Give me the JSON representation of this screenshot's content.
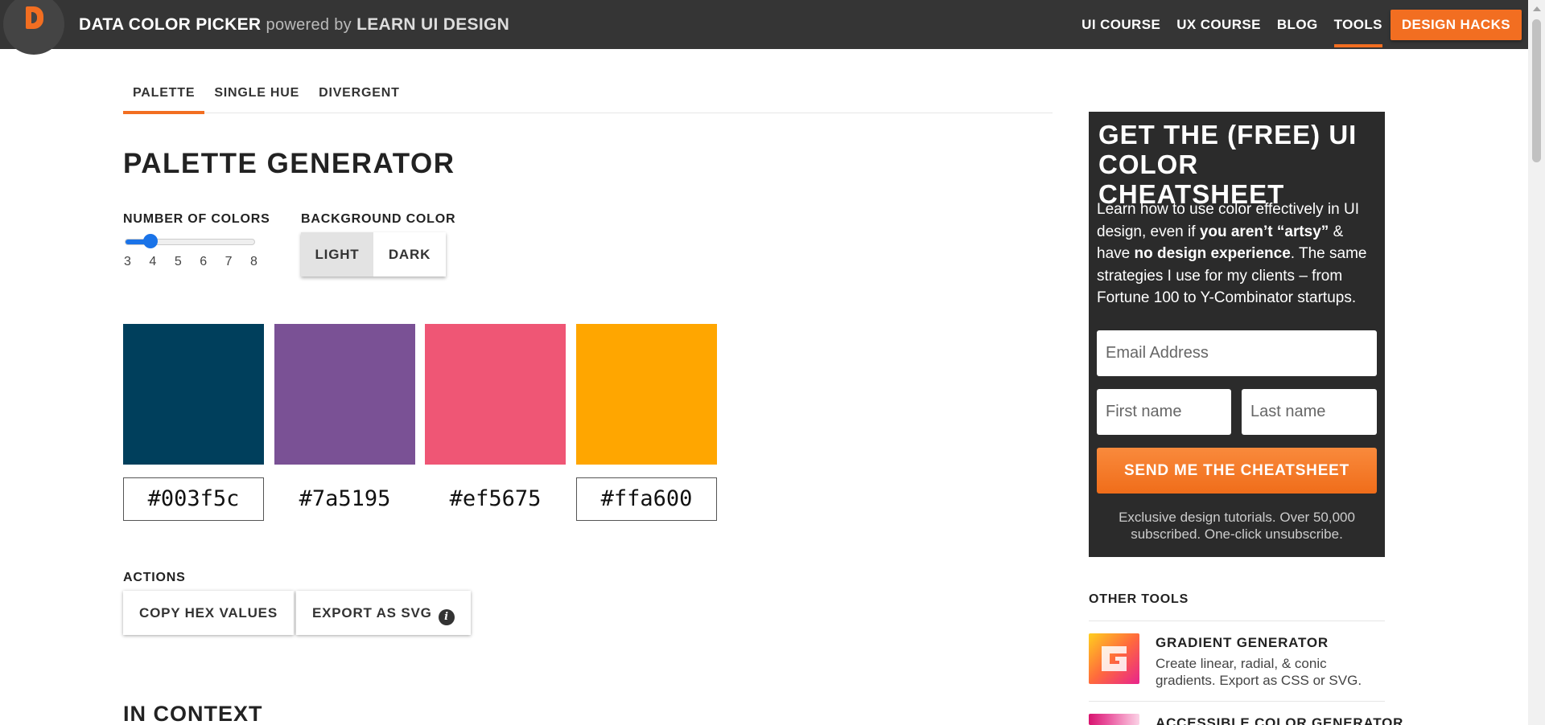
{
  "header": {
    "brand": "DATA COLOR PICKER",
    "powered_by": "powered by",
    "brand_parent": "LEARN UI DESIGN",
    "nav": [
      "UI COURSE",
      "UX COURSE",
      "BLOG",
      "TOOLS"
    ],
    "cta": "DESIGN HACKS",
    "accent": "#f26e21"
  },
  "tabs": [
    "PALETTE",
    "SINGLE HUE",
    "DIVERGENT"
  ],
  "page_title": "PALETTE GENERATOR",
  "controls": {
    "num_colors_label": "NUMBER OF COLORS",
    "ticks": [
      "3",
      "4",
      "5",
      "6",
      "7",
      "8"
    ],
    "selected_count": 4,
    "bg_label": "BACKGROUND COLOR",
    "bg_options": [
      "LIGHT",
      "DARK"
    ],
    "bg_selected": "LIGHT"
  },
  "palette": [
    {
      "hex": "#003f5c",
      "label": "#003f5c"
    },
    {
      "hex": "#7a5195",
      "label": "#7a5195"
    },
    {
      "hex": "#ef5675",
      "label": "#ef5675"
    },
    {
      "hex": "#ffa600",
      "label": "#ffa600"
    }
  ],
  "actions": {
    "label": "ACTIONS",
    "copy": "COPY HEX VALUES",
    "export": "EXPORT AS SVG"
  },
  "in_context": "IN CONTEXT",
  "signup": {
    "title": "GET THE (FREE) UI COLOR CHEATSHEET",
    "body_1": "Learn how to use color effectively in UI design, even if ",
    "body_b1": "you aren’t “artsy”",
    "body_2": " & have ",
    "body_b2": "no design experience",
    "body_3": ". The same strategies I use for my clients – from Fortune 100 to Y-Combinator startups.",
    "email_placeholder": "Email Address",
    "first_placeholder": "First name",
    "last_placeholder": "Last name",
    "button": "SEND ME THE CHEATSHEET",
    "footer": "Exclusive design tutorials. Over 50,000 subscribed. One-click unsubscribe."
  },
  "other_tools": {
    "title": "OTHER TOOLS",
    "items": [
      {
        "name": "GRADIENT GENERATOR",
        "desc": "Create linear, radial, & conic gradients. Export as CSS or SVG."
      },
      {
        "name": "ACCESSIBLE COLOR GENERATOR",
        "desc": ""
      }
    ]
  }
}
